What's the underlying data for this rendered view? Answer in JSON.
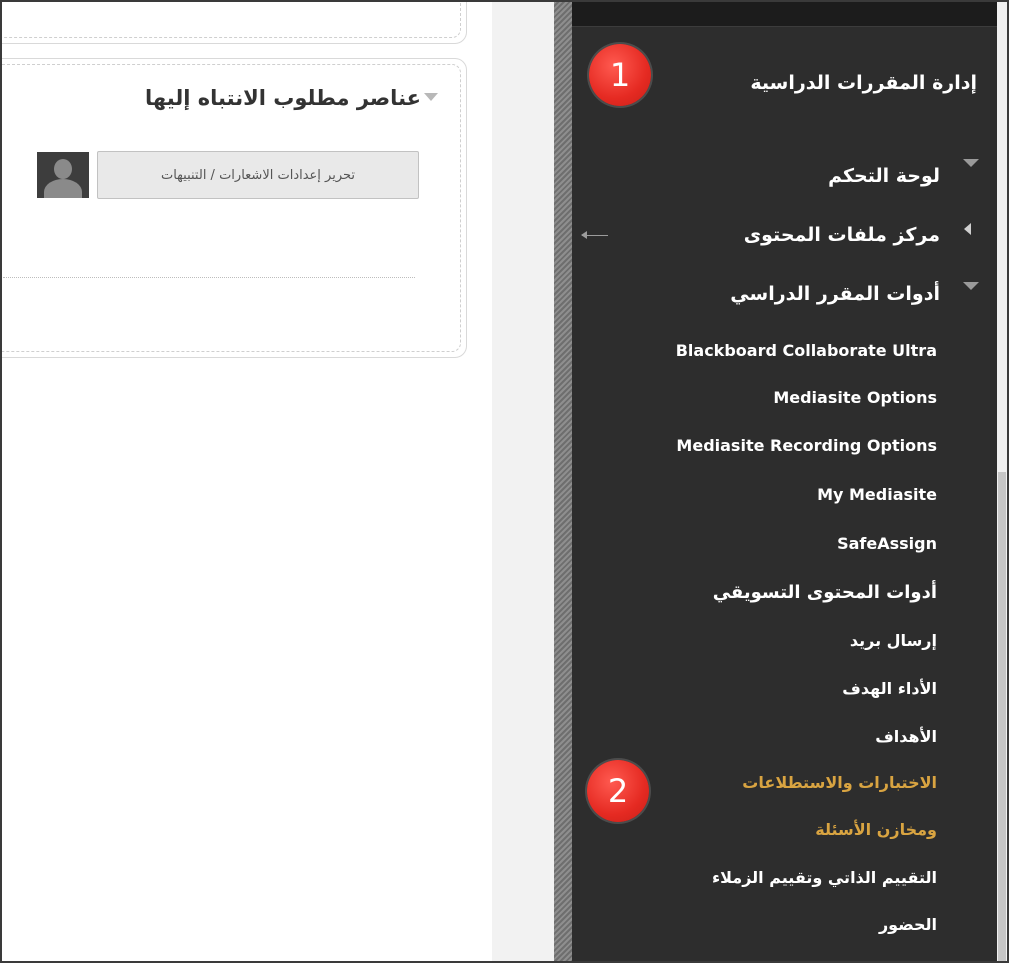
{
  "content": {
    "module_title": "عناصر مطلوب الانتباه إليها",
    "edit_button_label": "تحرير إعدادات الاشعارات / التنبيهات"
  },
  "sidebar": {
    "header": "إدارة المقررات الدراسية",
    "sections": [
      {
        "label": "لوحة التحكم",
        "state": "collapsed"
      },
      {
        "label": "مركز ملفات المحتوى",
        "state": "collapsed"
      },
      {
        "label": "أدوات المقرر الدراسي",
        "state": "expanded"
      }
    ],
    "tools": [
      "Blackboard Collaborate Ultra",
      "Mediasite Options",
      "Mediasite Recording Options",
      "My Mediasite",
      "SafeAssign",
      "أدوات المحتوى التسويقي",
      "إرسال بريد",
      "الأداء الهدف",
      "الأهداف",
      "الاختبارات والاستطلاعات",
      "ومخازن الأسئلة",
      "التقييم الذاتي وتقييم الزملاء",
      "الحضور"
    ],
    "selected_color": "#d9a441"
  },
  "callouts": {
    "step_1": "1",
    "step_2": "2"
  }
}
